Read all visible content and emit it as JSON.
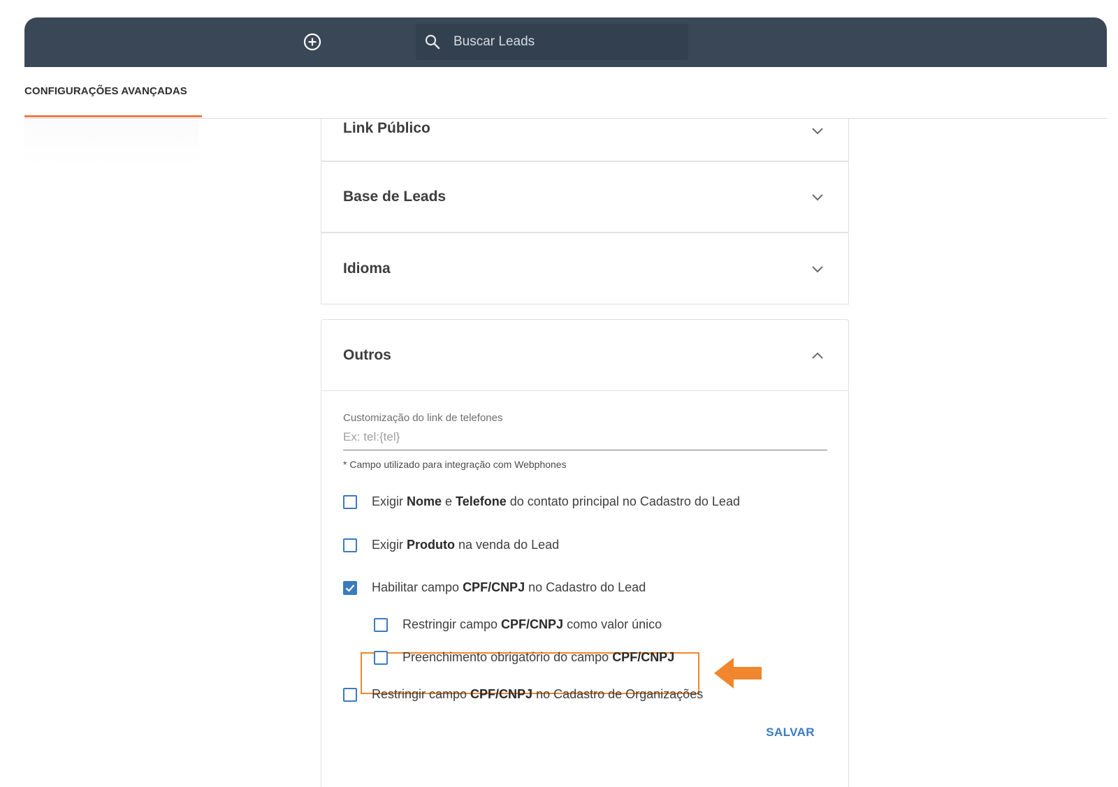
{
  "header": {
    "search_placeholder": "Buscar Leads",
    "icons": [
      "add-circle-icon",
      "search-icon"
    ],
    "colors": {
      "bar": "#3a4757",
      "search_bg": "#33404f"
    }
  },
  "tabs": [
    {
      "label": "CONFIGURAÇÕES AVANÇADAS",
      "active": true
    }
  ],
  "accent_color": "#ef7a4b",
  "sections": {
    "link_publico": "Link Público",
    "base_leads": "Base de Leads",
    "idioma": "Idioma",
    "outros": "Outros"
  },
  "outros": {
    "phone_field": {
      "label": "Customização do link de telefones",
      "placeholder": "Ex: tel:{tel}",
      "hint": "* Campo utilizado para integração com Webphones"
    },
    "options": [
      {
        "t1": "Exigir ",
        "b1": "Nome",
        "t2": " e ",
        "b2": "Telefone",
        "t3": " do contato principal no Cadastro do Lead",
        "checked": false
      },
      {
        "t1": "Exigir ",
        "b1": "Produto",
        "t2": " na venda do Lead",
        "checked": false
      },
      {
        "t1": "Habilitar campo ",
        "b1": "CPF/CNPJ",
        "t2": " no Cadastro do Lead",
        "checked": true
      },
      {
        "t1": "Restringir campo ",
        "b1": "CPF/CNPJ",
        "t2": " como valor único",
        "checked": false
      },
      {
        "t1": "Preenchimento obrigatório do campo ",
        "b1": "CPF/CNPJ",
        "checked": false
      },
      {
        "t1": "Restringir campo ",
        "b1": "CPF/CNPJ",
        "t2": " no Cadastro de Organizações",
        "checked": false
      }
    ],
    "save_label": "SALVAR"
  },
  "annotation": {
    "color": "#f0862e",
    "icon": "arrow-left-icon"
  },
  "checkbox_color": "#3b7bbf"
}
